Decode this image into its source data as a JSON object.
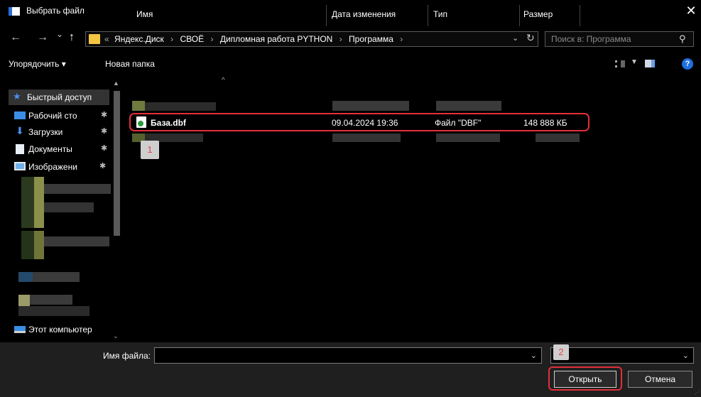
{
  "window": {
    "title": "Выбрать файл",
    "close_glyph": "✕"
  },
  "nav": {
    "back_glyph": "←",
    "forward_glyph": "→",
    "recent_glyph": "⌄",
    "up_glyph": "↑",
    "breadcrumb_prefix": "«",
    "breadcrumbs": [
      "Яндекс.Диск",
      "СВОЁ",
      "Дипломная работа PYTHON",
      "Программа"
    ],
    "separator": "›",
    "search_placeholder": "Поиск в: Программа",
    "search_icon": "search-icon"
  },
  "toolbar": {
    "organize_label": "Упорядочить ▾",
    "new_folder_label": "Новая папка",
    "help_label": "?"
  },
  "sidebar": {
    "items": [
      {
        "label": "Быстрый доступ",
        "icon": "star-icon"
      },
      {
        "label": "Рабочий сто",
        "icon": "desktop-icon",
        "pinned": true
      },
      {
        "label": "Загрузки",
        "icon": "download-icon",
        "pinned": true
      },
      {
        "label": "Документы",
        "icon": "document-icon",
        "pinned": true
      },
      {
        "label": "Изображени",
        "icon": "image-icon",
        "pinned": true
      },
      {
        "label": "Этот компьютер",
        "icon": "computer-icon"
      }
    ],
    "pin_glyph": "✱"
  },
  "file_list": {
    "columns": {
      "name": "Имя",
      "modified": "Дата изменения",
      "type": "Тип",
      "size": "Размер"
    },
    "selected_file": {
      "name": "База.dbf",
      "modified": "09.04.2024 19:36",
      "type": "Файл \"DBF\"",
      "size": "148 888 КБ"
    }
  },
  "markers": {
    "first": "1",
    "second": "2"
  },
  "bottom": {
    "filename_label": "Имя файла:",
    "filename_value": "",
    "open_label": "Открыть",
    "cancel_label": "Отмена"
  },
  "colors": {
    "highlight_ring": "#e1303a",
    "accent_blue": "#1e6fe0",
    "folder_yellow": "#f4c542",
    "dbf_green": "#2c9b3c"
  }
}
